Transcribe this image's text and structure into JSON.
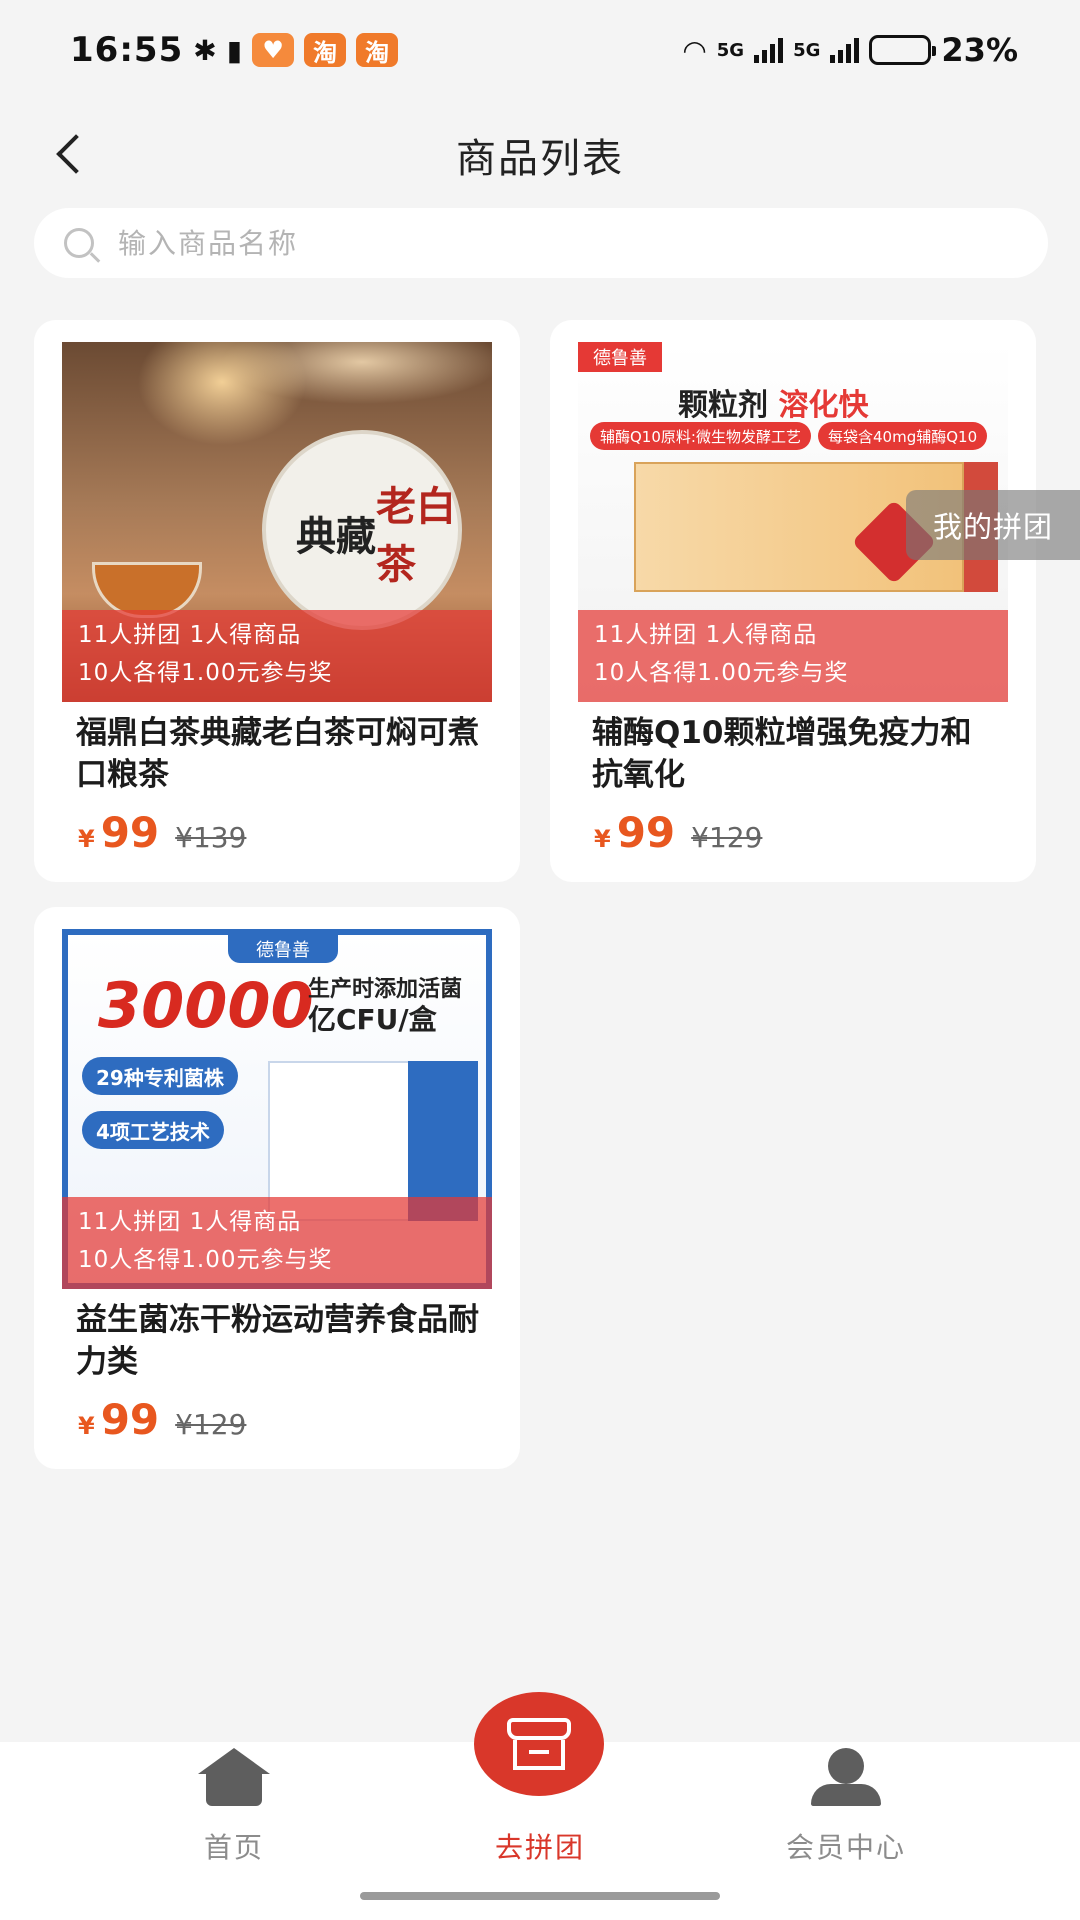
{
  "status_bar": {
    "time": "16:55",
    "network_1": "5G",
    "network_2": "5G",
    "battery_level": 0.23,
    "battery_percent": "23%",
    "app_badge_1": "淘",
    "app_badge_2": "淘"
  },
  "header": {
    "title": "商品列表"
  },
  "search": {
    "placeholder": "输入商品名称"
  },
  "products": [
    {
      "promo_line1": "11人拼团 1人得商品",
      "promo_line2": "10人各得1.00元参与奖",
      "title": "福鼎白茶典藏老白茶可焖可煮口粮茶",
      "currency": "¥",
      "price": "99",
      "original_price": "¥139",
      "art_text_1": "典藏",
      "art_text_2": "老白茶"
    },
    {
      "promo_line1": "11人拼团 1人得商品",
      "promo_line2": "10人各得1.00元参与奖",
      "title": "辅酶Q10颗粒增强免疫力和抗氧化",
      "currency": "¥",
      "price": "99",
      "original_price": "¥129",
      "art_brand": "德鲁善",
      "art_head_a": "颗粒剂",
      "art_head_b": "溶化快",
      "art_pill_1": "辅酶Q10原料:微生物发酵工艺",
      "art_pill_2": "每袋含40mg辅酶Q10"
    },
    {
      "promo_line1": "11人拼团 1人得商品",
      "promo_line2": "10人各得1.00元参与奖",
      "title": "益生菌冻干粉运动营养食品耐力类",
      "currency": "¥",
      "price": "99",
      "original_price": "¥129",
      "art_brand": "德鲁善",
      "art_big": "30000",
      "art_cfu_1": "生产时添加活菌",
      "art_cfu_2": "亿CFU/盒",
      "art_tag_1": "29种专利菌株",
      "art_tag_2": "4项工艺技术"
    }
  ],
  "floating_button": {
    "label": "我的拼团"
  },
  "tab_bar": {
    "home": "首页",
    "group": "去拼团",
    "member": "会员中心",
    "active": "group"
  },
  "colors": {
    "accent": "#d9372a",
    "price": "#e8571f",
    "background": "#f4f4f4"
  },
  "icons": {
    "back": "chevron-left-icon",
    "search": "search-icon",
    "home": "home-icon",
    "group": "store-icon",
    "member": "user-icon"
  }
}
